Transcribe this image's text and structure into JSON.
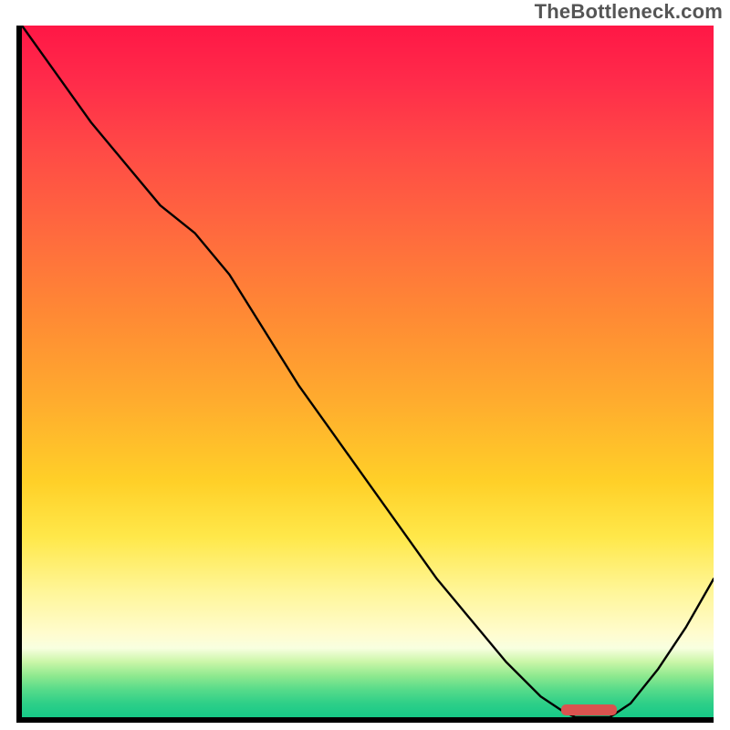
{
  "watermark": "TheBottleneck.com",
  "colors": {
    "axis": "#000000",
    "curve": "#000000",
    "marker": "#d9534f",
    "gradient_top": "#ff1746",
    "gradient_mid1": "#ff8a34",
    "gradient_mid2": "#ffe84a",
    "gradient_bottom": "#16c987"
  },
  "chart_data": {
    "type": "line",
    "title": "",
    "xlabel": "",
    "ylabel": "",
    "xlim": [
      0,
      100
    ],
    "ylim": [
      0,
      100
    ],
    "x": [
      0,
      5,
      10,
      15,
      20,
      25,
      30,
      35,
      40,
      45,
      50,
      55,
      60,
      65,
      70,
      75,
      78,
      80,
      82,
      85,
      88,
      92,
      96,
      100
    ],
    "values": [
      100,
      93,
      86,
      80,
      74,
      70,
      64,
      56,
      48,
      41,
      34,
      27,
      20,
      14,
      8,
      3,
      1,
      0,
      0,
      0,
      2,
      7,
      13,
      20
    ],
    "optimum_marker": {
      "x_start": 78,
      "x_end": 86,
      "y": 0
    },
    "legend": [],
    "grid": false
  }
}
